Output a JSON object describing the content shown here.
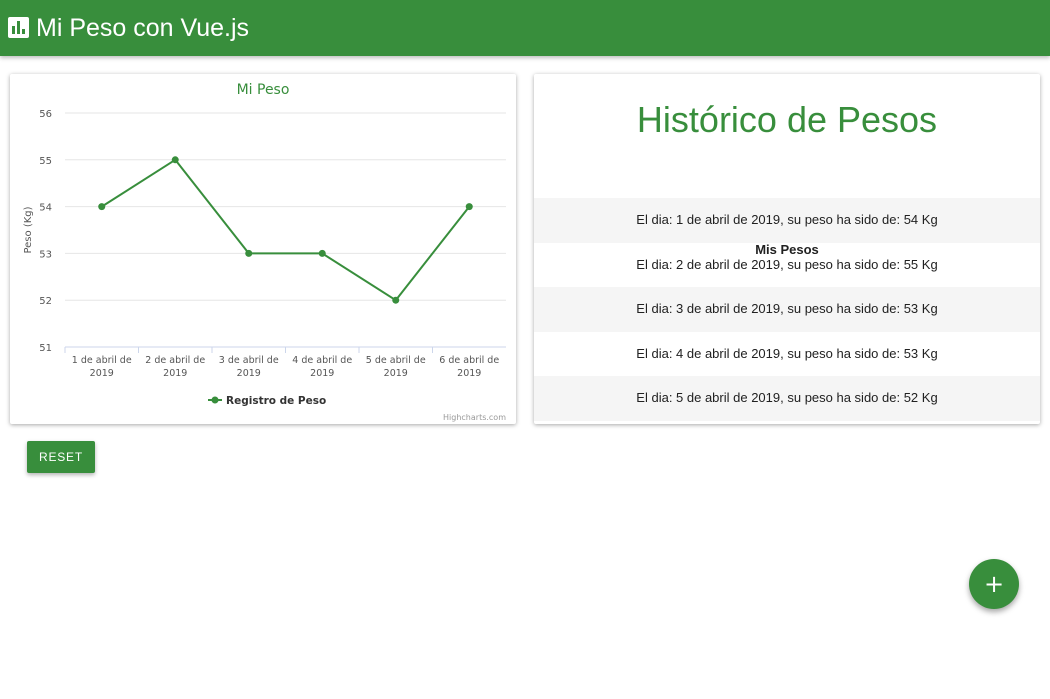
{
  "app": {
    "title": "Mi Peso con Vue.js",
    "icon": "bar-chart-icon",
    "accent": "#388e3c"
  },
  "history": {
    "title": "Histórico de Pesos",
    "header": "Mis Pesos",
    "rows": [
      "El dia: 1 de abril de 2019, su peso ha sido de: 54 Kg",
      "El dia: 2 de abril de 2019, su peso ha sido de: 55 Kg",
      "El dia: 3 de abril de 2019, su peso ha sido de: 53 Kg",
      "El dia: 4 de abril de 2019, su peso ha sido de: 53 Kg",
      "El dia: 5 de abril de 2019, su peso ha sido de: 52 Kg"
    ]
  },
  "actions": {
    "reset_label": "RESET",
    "fab_icon": "plus-icon",
    "fab_glyph": "+"
  },
  "chart_data": {
    "type": "line",
    "title": "Mi Peso",
    "ylabel": "Peso (Kg)",
    "xlabel": "",
    "categories": [
      "1 de abril de 2019",
      "2 de abril de 2019",
      "3 de abril de 2019",
      "4 de abril de 2019",
      "5 de abril de 2019",
      "6 de abril de 2019"
    ],
    "series": [
      {
        "name": "Registro de Peso",
        "values": [
          54,
          55,
          53,
          53,
          52,
          54
        ],
        "color": "#388e3c"
      }
    ],
    "ylim": [
      51,
      56
    ],
    "yticks": [
      51,
      52,
      53,
      54,
      55,
      56
    ],
    "grid": true,
    "legend": "bottom-center",
    "credits": "Highcharts.com"
  }
}
